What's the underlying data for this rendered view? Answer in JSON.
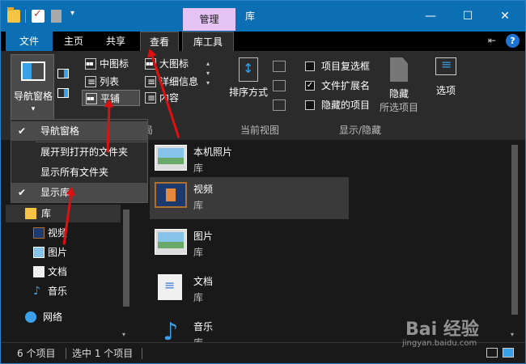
{
  "titlebar": {
    "context_tab": "管理",
    "title": "库",
    "minimize": "—",
    "maximize": "☐",
    "close": "✕",
    "dropdown_glyph": "▾"
  },
  "tabs": [
    "文件",
    "主页",
    "共享",
    "查看",
    "库工具"
  ],
  "ribbon": {
    "nav_pane_label": "导航窗格",
    "layout_items": [
      "中图标",
      "大图标",
      "列表",
      "详细信息",
      "平铺",
      "内容"
    ],
    "layout_group_label": "局",
    "sort_label": "排序方式",
    "current_view_label": "当前视图",
    "show_hide": {
      "item_checkbox": "项目复选框",
      "file_ext": "文件扩展名",
      "hidden_items": "隐藏的项目",
      "hide_button": "隐藏",
      "hide_sub": "所选项目",
      "group_label": "显示/隐藏"
    },
    "options_label": "选项"
  },
  "dropdown": {
    "items": [
      {
        "label": "导航窗格",
        "checked": true
      },
      {
        "label": "展开到打开的文件夹",
        "checked": false
      },
      {
        "label": "显示所有文件夹",
        "checked": false
      },
      {
        "label": "显示库",
        "checked": true
      }
    ]
  },
  "nav": {
    "library": "库",
    "children": [
      "视频",
      "图片",
      "文档",
      "音乐"
    ],
    "network": "网络"
  },
  "files": [
    {
      "name": "本机照片",
      "type": "库",
      "icon": "pictures-library-icon"
    },
    {
      "name": "视频",
      "type": "库",
      "icon": "video-library-icon"
    },
    {
      "name": "图片",
      "type": "库",
      "icon": "pictures-library-icon"
    },
    {
      "name": "文档",
      "type": "库",
      "icon": "documents-library-icon"
    },
    {
      "name": "音乐",
      "type": "库",
      "icon": "music-library-icon"
    }
  ],
  "status": {
    "count": "6 个项目",
    "selected": "选中 1 个项目"
  },
  "watermark": {
    "brand": "Bai 经验",
    "url": "jingyan.baidu.com"
  },
  "colors": {
    "accent": "#0d6fb3",
    "context_tab": "#e5c3f5",
    "annotation": "#e01010"
  }
}
